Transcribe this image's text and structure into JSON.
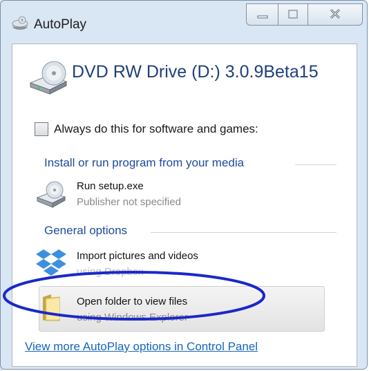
{
  "window": {
    "title": "AutoPlay"
  },
  "drive": {
    "title": "DVD RW Drive (D:) 3.0.9Beta15"
  },
  "always_checkbox": {
    "label": "Always do this for software and games:",
    "checked": false
  },
  "sections": {
    "install": "Install or run program from your media",
    "general": "General options"
  },
  "options": [
    {
      "title": "Run setup.exe",
      "subtitle": "Publisher not specified",
      "icon": "dvd-drive-icon"
    },
    {
      "title": "Import pictures and videos",
      "subtitle": "using Dropbox",
      "icon": "dropbox-icon"
    },
    {
      "title": "Open folder to view files",
      "subtitle": "using Windows Explorer",
      "icon": "folder-icon"
    }
  ],
  "link": {
    "label": "View more AutoPlay options in Control Panel"
  },
  "colors": {
    "accent_blue": "#1e4a9c",
    "link_blue": "#1565b8",
    "annotation_ellipse": "#1a28c8"
  }
}
